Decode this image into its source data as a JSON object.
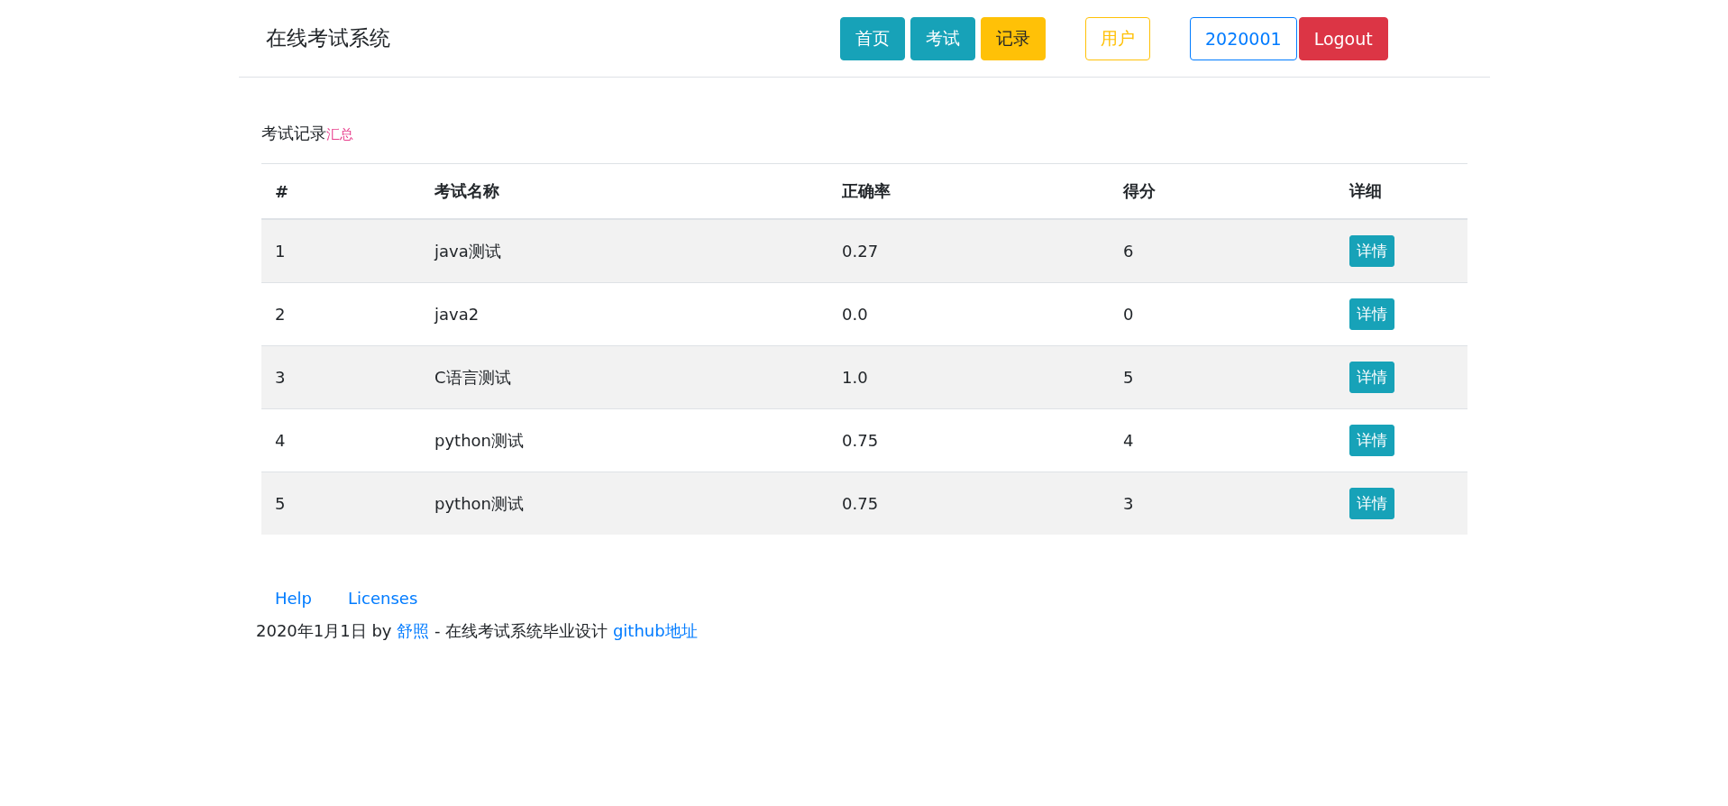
{
  "navbar": {
    "brand": "在线考试系统",
    "buttons": [
      {
        "label": "首页",
        "kind": "info"
      },
      {
        "label": "考试",
        "kind": "info"
      },
      {
        "label": "记录",
        "kind": "warning"
      },
      {
        "label": "用户",
        "kind": "outline-warning"
      },
      {
        "label": "2020001",
        "kind": "outline-primary"
      },
      {
        "label": "Logout",
        "kind": "danger"
      }
    ]
  },
  "heading": {
    "title": "考试记录",
    "subtitle": "汇总"
  },
  "table": {
    "columns": [
      "#",
      "考试名称",
      "正确率",
      "得分",
      "详细"
    ],
    "rows": [
      {
        "cells": [
          "1",
          "java测试",
          "0.27",
          "6"
        ],
        "action": "详情"
      },
      {
        "cells": [
          "2",
          "java2",
          "0.0",
          "0"
        ],
        "action": "详情"
      },
      {
        "cells": [
          "3",
          "C语言测试",
          "1.0",
          "5"
        ],
        "action": "详情"
      },
      {
        "cells": [
          "4",
          "python测试",
          "0.75",
          "4"
        ],
        "action": "详情"
      },
      {
        "cells": [
          "5",
          "python测试",
          "0.75",
          "3"
        ],
        "action": "详情"
      }
    ]
  },
  "footer": {
    "links": [
      "Help",
      "Licenses"
    ],
    "credit": [
      {
        "text": "2020年1月1日 by ",
        "link": false
      },
      {
        "text": "舒照",
        "link": true
      },
      {
        "text": " - 在线考试系统毕业设计 ",
        "link": false
      },
      {
        "text": "github地址",
        "link": true
      }
    ]
  }
}
